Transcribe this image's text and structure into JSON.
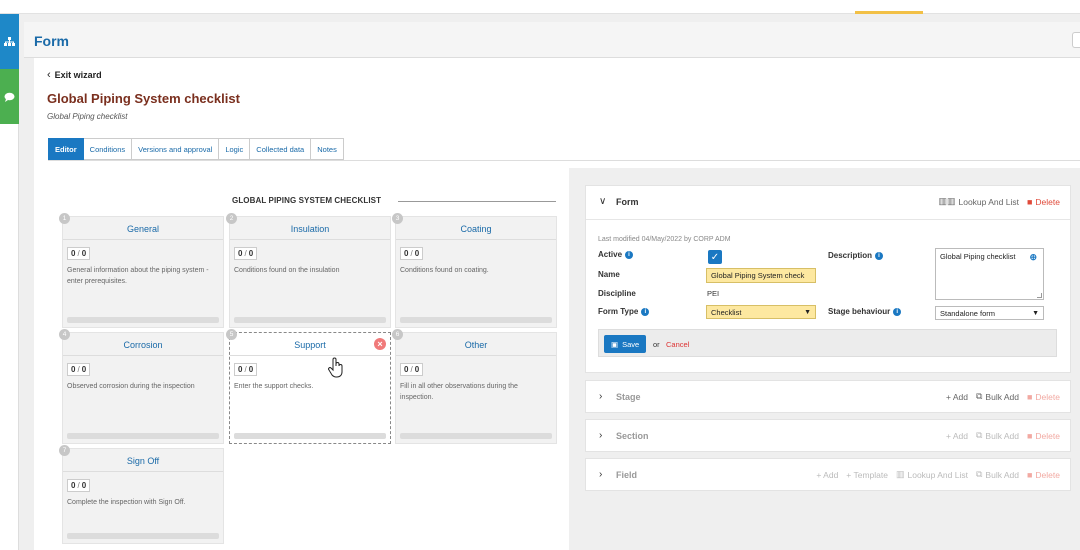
{
  "header": {
    "title": "Form"
  },
  "nav": {
    "exit_label": "Exit wizard"
  },
  "form": {
    "title": "Global Piping System checklist",
    "subtitle": "Global Piping checklist"
  },
  "tabs": [
    {
      "label": "Editor",
      "active": true
    },
    {
      "label": "Conditions"
    },
    {
      "label": "Versions and approval"
    },
    {
      "label": "Logic"
    },
    {
      "label": "Collected data"
    },
    {
      "label": "Notes"
    }
  ],
  "checklist": {
    "title": "GLOBAL PIPING SYSTEM CHECKLIST",
    "cards": [
      {
        "num": "1",
        "title": "General",
        "done": "0",
        "total": "0",
        "desc": "General information about the piping system - enter prerequisites."
      },
      {
        "num": "2",
        "title": "Insulation",
        "done": "0",
        "total": "0",
        "desc": "Conditions found on the insulation"
      },
      {
        "num": "3",
        "title": "Coating",
        "done": "0",
        "total": "0",
        "desc": "Conditions found on coating."
      },
      {
        "num": "4",
        "title": "Corrosion",
        "done": "0",
        "total": "0",
        "desc": "Observed corrosion during the inspection"
      },
      {
        "num": "5",
        "title": "Support",
        "done": "0",
        "total": "0",
        "desc": "Enter the support checks."
      },
      {
        "num": "6",
        "title": "Other",
        "done": "0",
        "total": "0",
        "desc": "Fill in all other observations during the inspection."
      },
      {
        "num": "7",
        "title": "Sign Off",
        "done": "0",
        "total": "0",
        "desc": "Complete the inspection with Sign Off."
      }
    ]
  },
  "panel": {
    "form": {
      "name": "Form",
      "lookup_label": "Lookup And List",
      "delete_label": "Delete",
      "last_modified": "Last modified 04/May/2022 by CORP ADM",
      "active_label": "Active",
      "active": true,
      "name_label": "Name",
      "name_value": "Global Piping System check",
      "discipline_label": "Discipline",
      "discipline_value": "PEI",
      "form_type_label": "Form Type",
      "form_type_value": "Checklist",
      "description_label": "Description",
      "description_value": "Global Piping checklist",
      "stage_behaviour_label": "Stage behaviour",
      "stage_behaviour_value": "Standalone form",
      "save_label": "Save",
      "or_label": "or",
      "cancel_label": "Cancel"
    },
    "stage": {
      "name": "Stage",
      "add": "+ Add",
      "bulk_add": "Bulk Add",
      "delete": "Delete"
    },
    "section": {
      "name": "Section",
      "add": "+ Add",
      "bulk_add": "Bulk Add",
      "delete": "Delete"
    },
    "field": {
      "name": "Field",
      "add": "+ Add",
      "template": "+ Template",
      "lookup": "Lookup And List",
      "bulk_add": "Bulk Add",
      "delete": "Delete"
    }
  }
}
